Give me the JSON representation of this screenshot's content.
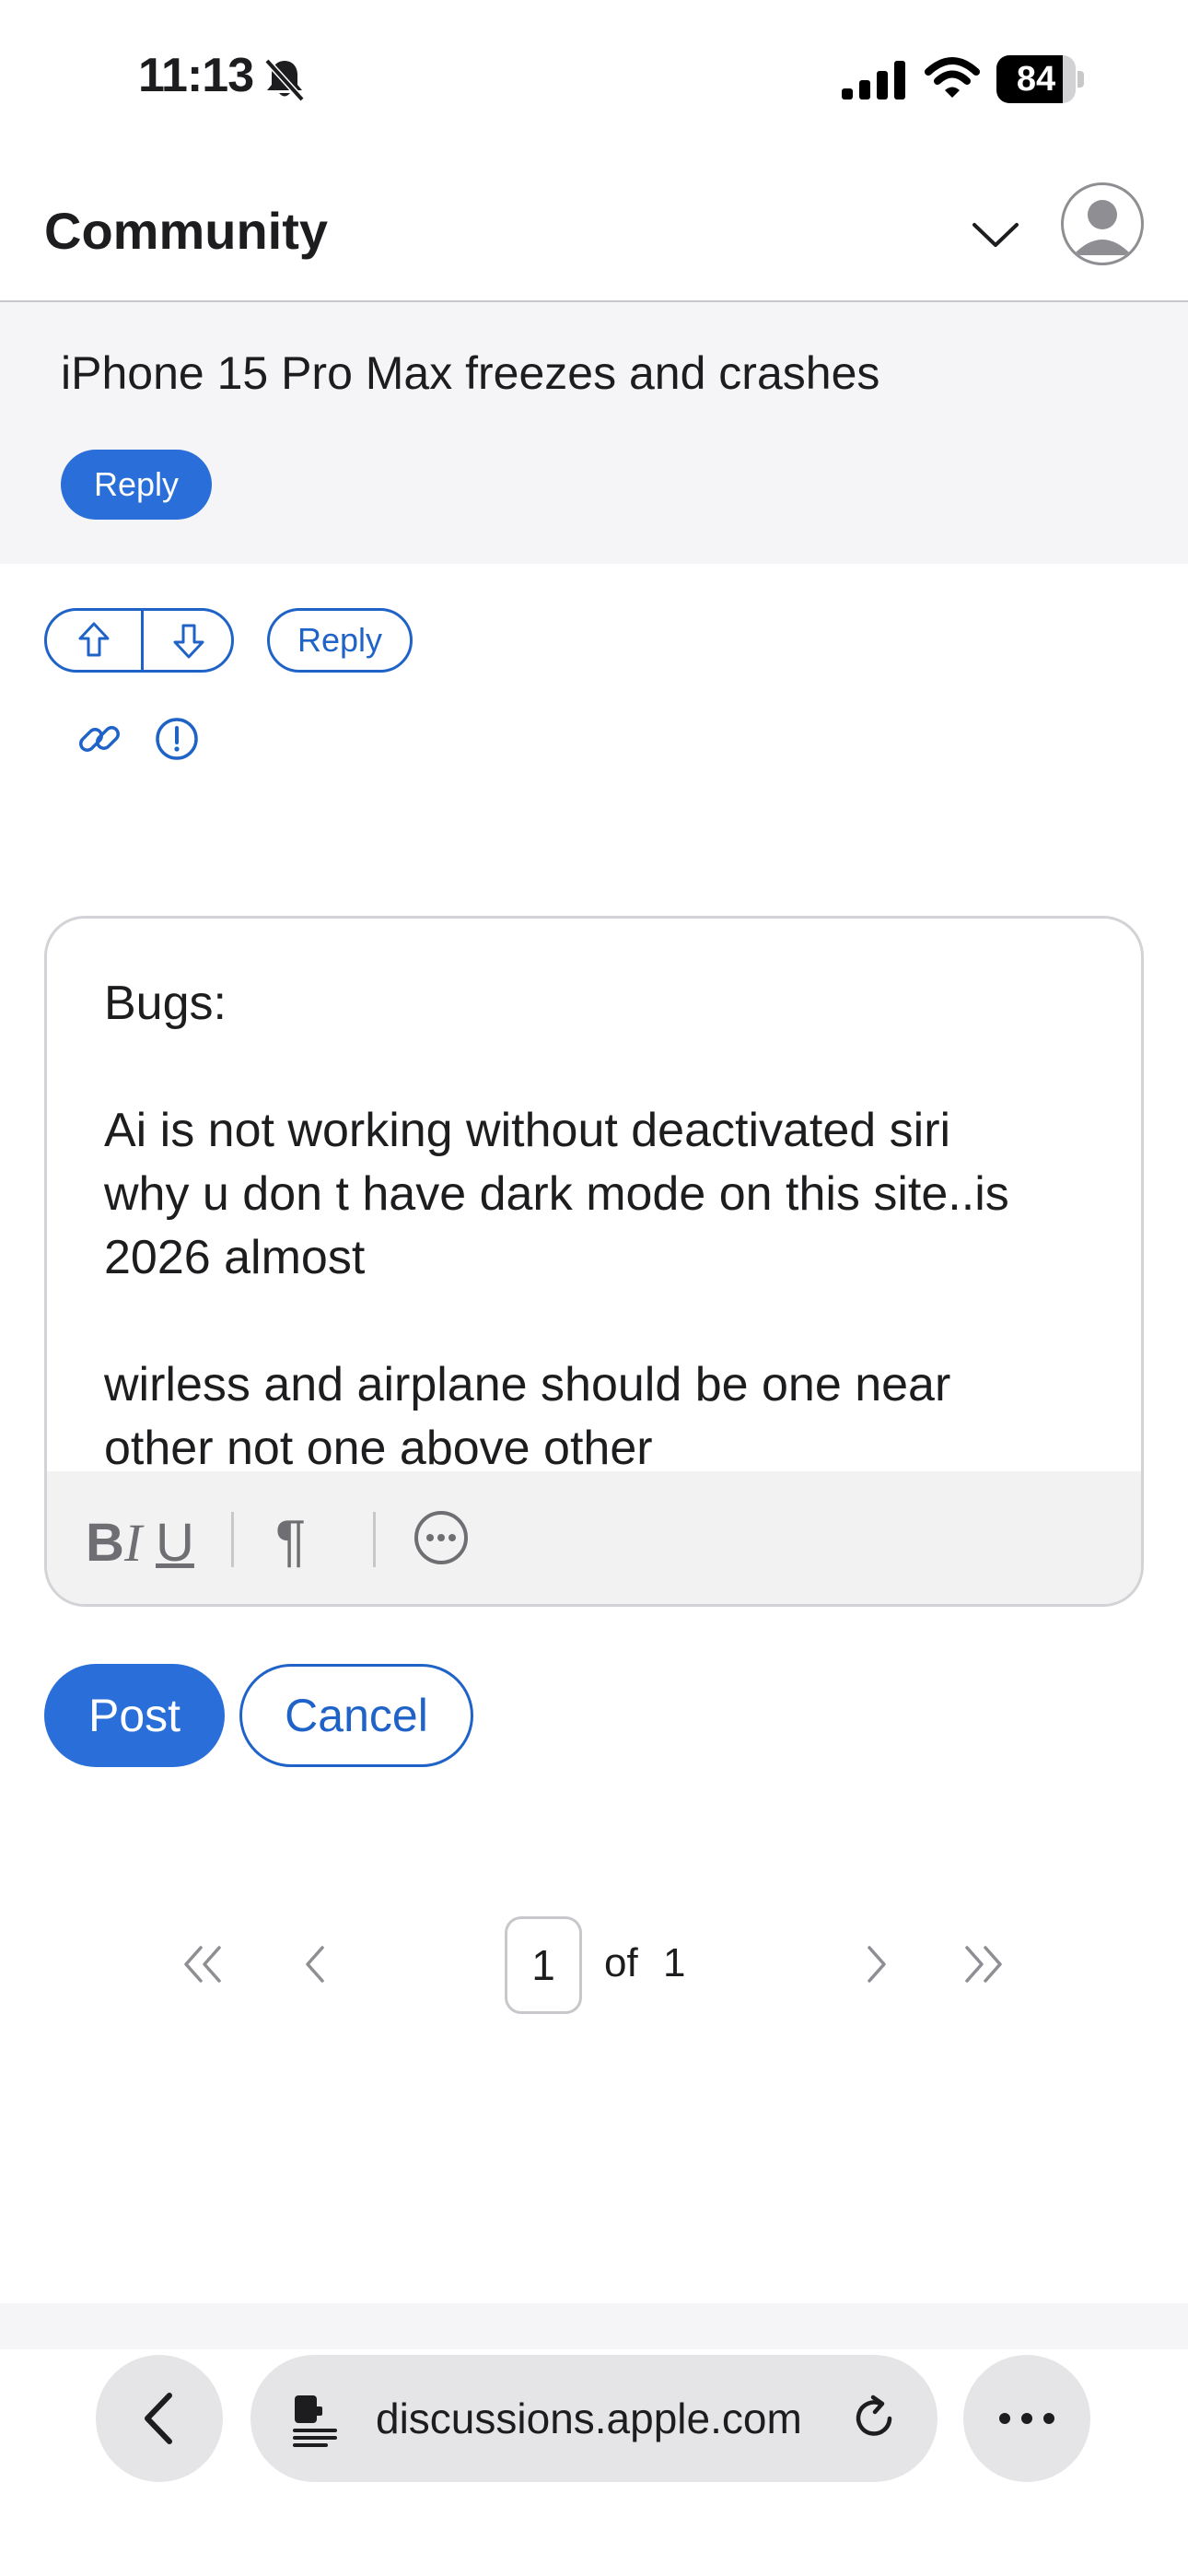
{
  "status_bar": {
    "time": "11:13",
    "battery": "84",
    "battery_fraction": 0.84
  },
  "header": {
    "title": "Community"
  },
  "thread": {
    "title": "iPhone 15 Pro Max freezes and crashes",
    "reply_label": "Reply"
  },
  "post_actions": {
    "reply_label": "Reply"
  },
  "editor": {
    "text": "Bugs:\n\nAi is not working without deactivated siri\nwhy u don t have dark mode on this site..is\n2026 almost\n\nwirless and airplane should be one near\nother not one above other",
    "toolbar": {
      "bold": "B",
      "italic": "I",
      "underline": "U",
      "paragraph": "¶"
    }
  },
  "buttons": {
    "post": "Post",
    "cancel": "Cancel"
  },
  "pagination": {
    "current": "1",
    "of_label": "of",
    "total": "1"
  },
  "browser": {
    "url": "discussions.apple.com"
  },
  "colors": {
    "accent": "#2a6fd9",
    "accent_outline": "#1f63c8",
    "bar_background": "#f5f5f7"
  },
  "icons": [
    "bell-slash-icon",
    "signal-icon",
    "wifi-icon",
    "battery-icon",
    "chevron-down-icon",
    "avatar-icon",
    "upvote-icon",
    "downvote-icon",
    "link-icon",
    "report-icon",
    "more-options-icon",
    "first-page-icon",
    "previous-page-icon",
    "next-page-icon",
    "last-page-icon",
    "back-icon",
    "page-menu-icon",
    "reload-icon",
    "ellipsis-icon"
  ]
}
